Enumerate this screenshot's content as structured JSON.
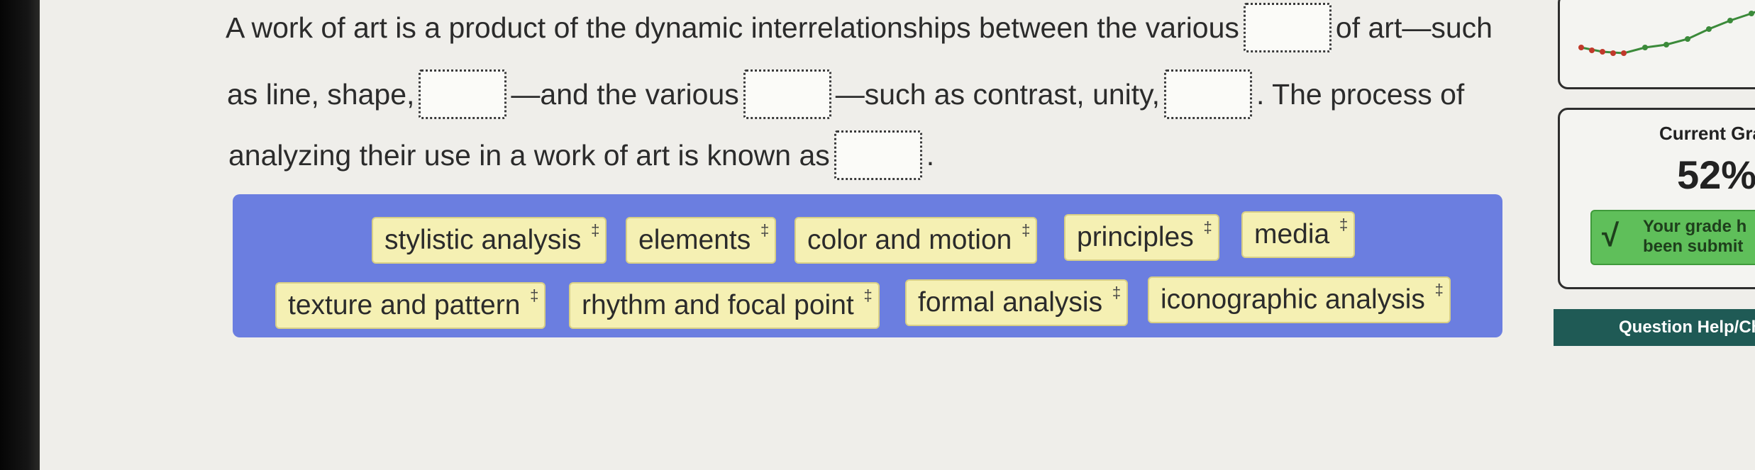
{
  "question": {
    "line1": {
      "before": "A work of art is a product of the dynamic interrelationships between the various",
      "after": "of art—such"
    },
    "line2": {
      "part1": "as line, shape,",
      "part2": "—and the various",
      "part3": "—such as contrast, unity,",
      "part4": ". The process of"
    },
    "line3": {
      "before": "analyzing their use in a work of art is known as",
      "after": "."
    }
  },
  "word_bank": {
    "row1": [
      "stylistic analysis",
      "elements",
      "color and motion",
      "principles",
      "media"
    ],
    "row2": [
      "texture and pattern",
      "rhythm and focal point",
      "formal analysis",
      "iconographic analysis"
    ],
    "chip_icon": "move-plus-icon",
    "plus_glyph": "‡"
  },
  "sidebar": {
    "grade_title": "Current Gra",
    "grade_value": "52%",
    "status_check": "√",
    "status_line1": "Your grade h",
    "status_line2": "been submit",
    "help_label": "Question Help/Ch"
  },
  "colors": {
    "bank_bg": "#6b7ee0",
    "chip_bg": "#f5f0b3",
    "status_green": "#5fbf5a",
    "help_bg": "#1f5a55"
  }
}
